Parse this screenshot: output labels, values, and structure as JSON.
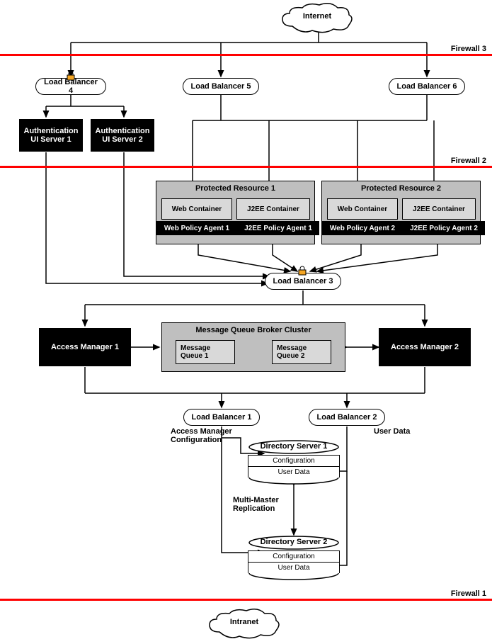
{
  "clouds": {
    "internet": "Internet",
    "intranet": "Intranet"
  },
  "firewalls": {
    "fw3": "Firewall 3",
    "fw2": "Firewall 2",
    "fw1": "Firewall 1"
  },
  "lb": {
    "lb1": "Load Balancer 1",
    "lb2": "Load Balancer 2",
    "lb3": "Load Balancer 3",
    "lb4": "Load Balancer 4",
    "lb5": "Load Balancer 5",
    "lb6": "Load Balancer 6"
  },
  "auth": {
    "s1": "Authentication UI Server  1",
    "s2": "Authentication UI  Server 2"
  },
  "pr1": {
    "title": "Protected Resource  1",
    "web": "Web Container",
    "j2ee": "J2EE Container",
    "wpa": "Web Policy Agent 1",
    "jpa": "J2EE Policy Agent 1"
  },
  "pr2": {
    "title": "Protected Resource  2",
    "web": "Web Container",
    "j2ee": "J2EE Container",
    "wpa": "Web Policy Agent 2",
    "jpa": "J2EE Policy Agent 2"
  },
  "am": {
    "am1": "Access Manager 1",
    "am2": "Access Manager 2"
  },
  "mq": {
    "title": "Message Queue Broker Cluster",
    "q1": "Message Queue 1",
    "q2": "Message Queue 2"
  },
  "ds": {
    "ds1_title": "Directory Server 1",
    "ds2_title": "Directory Server 2",
    "config": "Configuration",
    "userdata": "User Data"
  },
  "annot": {
    "am_cfg": "Access Manager Configuration",
    "user_data": "User Data",
    "mmr": "Multi-Master Replication"
  }
}
